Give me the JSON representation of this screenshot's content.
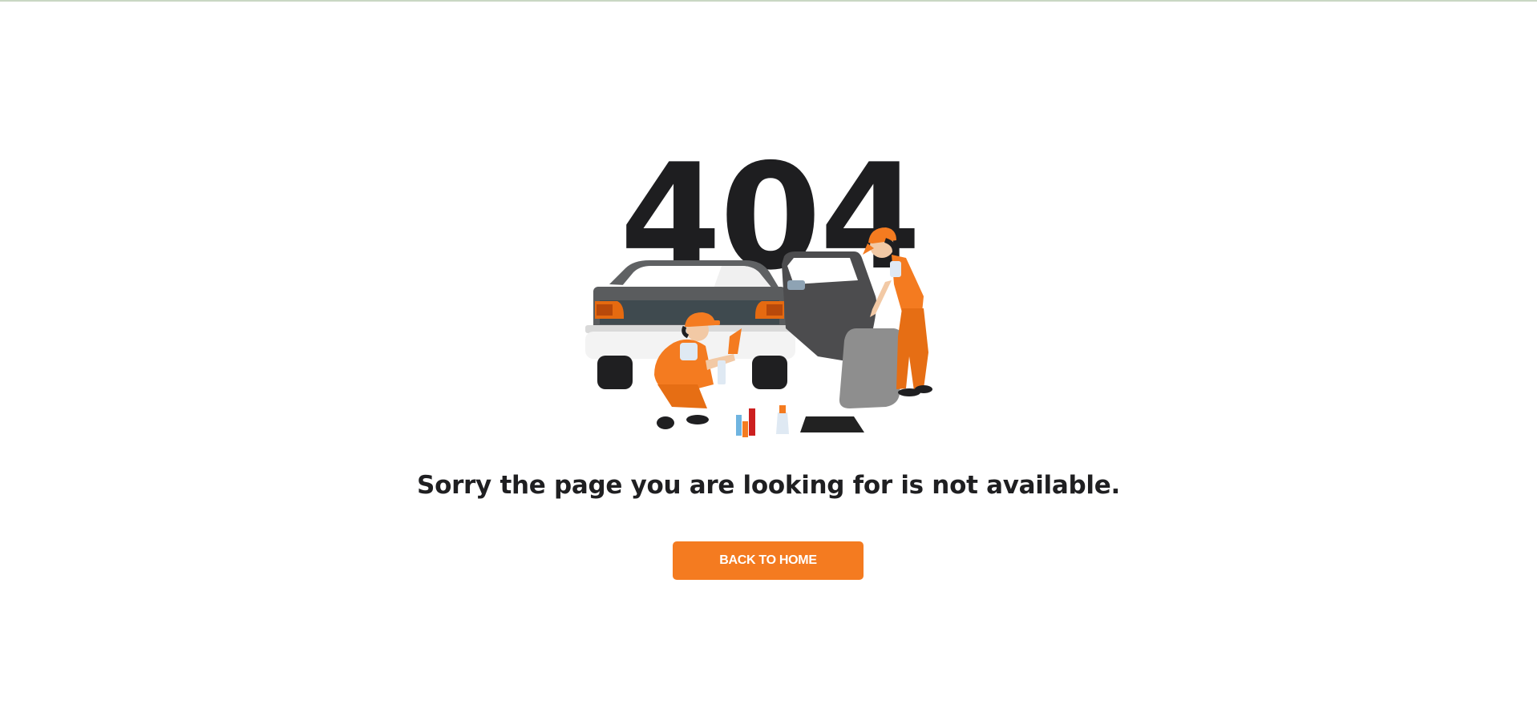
{
  "error_page": {
    "code": "404",
    "message": "Sorry the page you are looking for is not available.",
    "back_button_label": "BACK TO HOME"
  },
  "colors": {
    "accent": "#f47b20",
    "text": "#1f1f21",
    "car_body": "#5a5c5e",
    "bumper": "#f2f2f2"
  },
  "icons": [
    "car-illustration",
    "mechanic-illustration"
  ]
}
